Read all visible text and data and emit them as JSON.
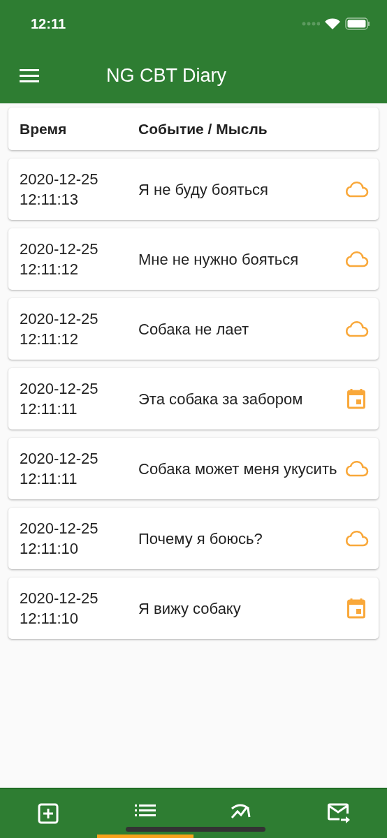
{
  "status_bar": {
    "time": "12:11"
  },
  "app_bar": {
    "title": "NG CBT Diary"
  },
  "table": {
    "columns": [
      "Время",
      "Событие / Мысль"
    ],
    "rows": [
      {
        "date": "2020-12-25",
        "time": "12:11:13",
        "text": "Я не буду бояться",
        "kind": "thought"
      },
      {
        "date": "2020-12-25",
        "time": "12:11:12",
        "text": "Мне не нужно бояться",
        "kind": "thought"
      },
      {
        "date": "2020-12-25",
        "time": "12:11:12",
        "text": "Собака не лает",
        "kind": "thought"
      },
      {
        "date": "2020-12-25",
        "time": "12:11:11",
        "text": "Эта собака за забором",
        "kind": "event"
      },
      {
        "date": "2020-12-25",
        "time": "12:11:11",
        "text": "Собака может меня укусить",
        "kind": "thought"
      },
      {
        "date": "2020-12-25",
        "time": "12:11:10",
        "text": "Почему я боюсь?",
        "kind": "thought"
      },
      {
        "date": "2020-12-25",
        "time": "12:11:10",
        "text": "Я вижу собаку",
        "kind": "event"
      }
    ]
  },
  "bottom_nav": [
    {
      "kind": "add",
      "selected": false
    },
    {
      "kind": "list",
      "selected": true
    },
    {
      "kind": "chart",
      "selected": false
    },
    {
      "kind": "mail",
      "selected": false
    }
  ]
}
